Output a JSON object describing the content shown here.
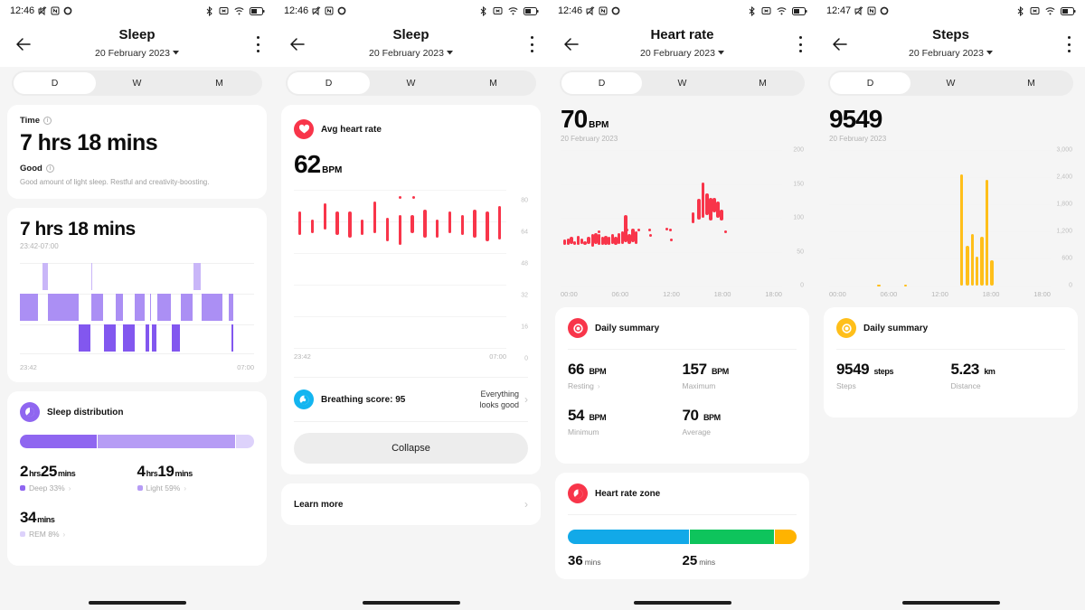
{
  "panels": [
    {
      "statusbar": {
        "time": "12:46",
        "icons": [
          "silent-icon",
          "nfc-icon",
          "record-icon",
          "bluetooth-icon",
          "alarm-icon",
          "wifi-icon",
          "battery-icon"
        ]
      },
      "appbar": {
        "title": "Sleep",
        "date": "20 February 2023",
        "back": "back-arrow-icon",
        "menu": "more-options-icon"
      },
      "tabs": [
        {
          "label": "D",
          "active": true
        },
        {
          "label": "W",
          "active": false
        },
        {
          "label": "M",
          "active": false
        }
      ],
      "time_card": {
        "label": "Time",
        "value": "7 hrs 18 mins",
        "quality": "Good",
        "description": "Good amount of light sleep. Restful and creativity-boosting."
      },
      "hypnogram_card": {
        "total": "7 hrs 18 mins",
        "range": "23:42-07:00",
        "axis_start": "23:42",
        "axis_end": "07:00"
      },
      "distribution": {
        "title": "Sleep distribution",
        "segments": [
          {
            "name": "Deep",
            "percent": 33,
            "color": "#8f66f0"
          },
          {
            "name": "Light",
            "percent": 59,
            "color": "#b69cf5"
          },
          {
            "name": "REM",
            "percent": 8,
            "color": "#ddd2fb"
          }
        ],
        "stats": [
          {
            "value": "2",
            "unit1": "hrs",
            "value2": "25",
            "unit2": "mins",
            "label": "Deep 33%",
            "color": "#8f66f0",
            "chevron": true
          },
          {
            "value": "4",
            "unit1": "hrs",
            "value2": "19",
            "unit2": "mins",
            "label": "Light 59%",
            "color": "#b69cf5",
            "chevron": true
          },
          {
            "value": "34",
            "unit1": "mins",
            "value2": "",
            "unit2": "",
            "label": "REM 8%",
            "color": "#ddd2fb",
            "chevron": true
          }
        ]
      }
    },
    {
      "statusbar": {
        "time": "12:46"
      },
      "appbar": {
        "title": "Sleep",
        "date": "20 February 2023"
      },
      "tabs": [
        {
          "label": "D",
          "active": true
        },
        {
          "label": "W",
          "active": false
        },
        {
          "label": "M",
          "active": false
        }
      ],
      "avg_hr": {
        "title": "Avg heart rate",
        "value": "62",
        "unit": "BPM",
        "axis_start": "23:42",
        "axis_end": "07:00"
      },
      "breathing": {
        "title": "Breathing score: 95",
        "status_line1": "Everything",
        "status_line2": "looks good"
      },
      "collapse_label": "Collapse",
      "learn_more_label": "Learn more"
    },
    {
      "statusbar": {
        "time": "12:46"
      },
      "appbar": {
        "title": "Heart rate",
        "date": "20 February 2023"
      },
      "tabs": [
        {
          "label": "D",
          "active": true
        },
        {
          "label": "W",
          "active": false
        },
        {
          "label": "M",
          "active": false
        }
      ],
      "hero": {
        "value": "70",
        "unit": "BPM",
        "date": "20 February 2023"
      },
      "summary": {
        "title": "Daily summary",
        "items": [
          {
            "value": "66",
            "unit": "BPM",
            "label": "Resting",
            "chevron": true
          },
          {
            "value": "157",
            "unit": "BPM",
            "label": "Maximum",
            "chevron": false
          },
          {
            "value": "54",
            "unit": "BPM",
            "label": "Minimum",
            "chevron": false
          },
          {
            "value": "70",
            "unit": "BPM",
            "label": "Average",
            "chevron": false
          }
        ]
      },
      "zone": {
        "title": "Heart rate zone",
        "segments": [
          {
            "color": "#12a9e8",
            "percent": 53
          },
          {
            "color": "#0ec45c",
            "percent": 37
          },
          {
            "color": "#ffb300",
            "percent": 10
          }
        ],
        "labels": [
          {
            "value": "36",
            "unit": "mins"
          },
          {
            "value": "25",
            "unit": "mins"
          }
        ]
      }
    },
    {
      "statusbar": {
        "time": "12:47"
      },
      "appbar": {
        "title": "Steps",
        "date": "20 February 2023"
      },
      "tabs": [
        {
          "label": "D",
          "active": true
        },
        {
          "label": "W",
          "active": false
        },
        {
          "label": "M",
          "active": false
        }
      ],
      "hero": {
        "value": "9549",
        "unit": "",
        "date": "20 February 2023"
      },
      "summary": {
        "title": "Daily summary",
        "items": [
          {
            "value": "9549",
            "unit": "steps",
            "label": "Steps",
            "chevron": false
          },
          {
            "value": "5.23",
            "unit": "km",
            "label": "Distance",
            "chevron": false
          }
        ]
      }
    }
  ],
  "colors": {
    "accent_sleep": "#8f66f0",
    "accent_hr": "#f8354a",
    "accent_breathing": "#13b5f0",
    "accent_steps": "#ffbf1a",
    "card_bg": "#ffffff",
    "page_bg": "#f5f5f5"
  },
  "chart_data": [
    {
      "id": "sleep-hypnogram",
      "type": "bar",
      "title": "7 hrs 18 mins",
      "subtitle": "23:42-07:00",
      "xlabel": "",
      "ylabel": "",
      "xticks": [
        "23:42",
        "07:00"
      ],
      "levels": [
        "REM",
        "Light",
        "Deep"
      ],
      "level_colors": {
        "REM": "#c9b6f8",
        "Light": "#ab8ff4",
        "Deep": "#8257ef"
      },
      "segments": [
        {
          "level": "Light",
          "start": 0.0,
          "width": 0.055
        },
        {
          "level": "Light",
          "start": 0.055,
          "width": 0.022
        },
        {
          "level": "REM",
          "start": 0.098,
          "width": 0.02
        },
        {
          "level": "Light",
          "start": 0.118,
          "width": 0.002
        },
        {
          "level": "Light",
          "start": 0.122,
          "width": 0.128
        },
        {
          "level": "Deep",
          "start": 0.25,
          "width": 0.052
        },
        {
          "level": "REM",
          "start": 0.305,
          "width": 0.004
        },
        {
          "level": "Light",
          "start": 0.305,
          "width": 0.05
        },
        {
          "level": "Deep",
          "start": 0.358,
          "width": 0.05
        },
        {
          "level": "Light",
          "start": 0.41,
          "width": 0.03
        },
        {
          "level": "Deep",
          "start": 0.441,
          "width": 0.048
        },
        {
          "level": "Light",
          "start": 0.492,
          "width": 0.042
        },
        {
          "level": "Deep",
          "start": 0.537,
          "width": 0.014
        },
        {
          "level": "Light",
          "start": 0.555,
          "width": 0.006
        },
        {
          "level": "Deep",
          "start": 0.562,
          "width": 0.02
        },
        {
          "level": "Light",
          "start": 0.585,
          "width": 0.06
        },
        {
          "level": "Deep",
          "start": 0.648,
          "width": 0.035
        },
        {
          "level": "Light",
          "start": 0.686,
          "width": 0.05
        },
        {
          "level": "REM",
          "start": 0.74,
          "width": 0.033
        },
        {
          "level": "Light",
          "start": 0.775,
          "width": 0.09
        },
        {
          "level": "Light",
          "start": 0.89,
          "width": 0.02
        },
        {
          "level": "Deep",
          "start": 0.905,
          "width": 0.006
        }
      ]
    },
    {
      "id": "sleep-heart-rate",
      "type": "bar",
      "title": "Avg heart rate",
      "subtitle": "62 BPM",
      "ylim": [
        0,
        80
      ],
      "yticks": [
        0,
        16,
        32,
        48,
        64,
        80
      ],
      "xticks": [
        "23:42",
        "07:00"
      ],
      "ranges": [
        {
          "low": 57,
          "high": 69
        },
        {
          "low": 58,
          "high": 65
        },
        {
          "low": 60,
          "high": 73
        },
        {
          "low": 57,
          "high": 69
        },
        {
          "low": 56,
          "high": 69
        },
        {
          "low": 57,
          "high": 65
        },
        {
          "low": 58,
          "high": 74
        },
        {
          "low": 54,
          "high": 66
        },
        {
          "low": 52,
          "high": 67
        },
        {
          "low": 58,
          "high": 67
        },
        {
          "low": 56,
          "high": 70
        },
        {
          "low": 56,
          "high": 65
        },
        {
          "low": 58,
          "high": 69
        },
        {
          "low": 57,
          "high": 67
        },
        {
          "low": 56,
          "high": 70
        },
        {
          "low": 54,
          "high": 69
        },
        {
          "low": 55,
          "high": 72
        }
      ],
      "points": [
        {
          "x": 0.5,
          "y": 77
        },
        {
          "x": 0.565,
          "y": 77
        }
      ]
    },
    {
      "id": "heart-rate-day",
      "type": "bar",
      "title": "70 BPM",
      "subtitle": "20 February 2023",
      "ylim": [
        0,
        200
      ],
      "yticks": [
        0,
        50,
        100,
        150,
        200
      ],
      "xticks": [
        "00:00",
        "06:00",
        "12:00",
        "18:00",
        "18:00"
      ],
      "ranges": [
        {
          "x": 0.02,
          "low": 60,
          "high": 68
        },
        {
          "x": 0.035,
          "low": 60,
          "high": 70
        },
        {
          "x": 0.05,
          "low": 62,
          "high": 72
        },
        {
          "x": 0.065,
          "low": 60,
          "high": 66
        },
        {
          "x": 0.082,
          "low": 60,
          "high": 74
        },
        {
          "x": 0.098,
          "low": 62,
          "high": 70
        },
        {
          "x": 0.112,
          "low": 60,
          "high": 66
        },
        {
          "x": 0.128,
          "low": 61,
          "high": 72
        },
        {
          "x": 0.145,
          "low": 58,
          "high": 76
        },
        {
          "x": 0.16,
          "low": 62,
          "high": 78
        },
        {
          "x": 0.175,
          "low": 60,
          "high": 76
        },
        {
          "x": 0.19,
          "low": 60,
          "high": 72
        },
        {
          "x": 0.205,
          "low": 60,
          "high": 74
        },
        {
          "x": 0.22,
          "low": 60,
          "high": 72
        },
        {
          "x": 0.236,
          "low": 62,
          "high": 76
        },
        {
          "x": 0.25,
          "low": 60,
          "high": 72
        },
        {
          "x": 0.265,
          "low": 62,
          "high": 78
        },
        {
          "x": 0.28,
          "low": 62,
          "high": 80
        },
        {
          "x": 0.295,
          "low": 64,
          "high": 104
        },
        {
          "x": 0.312,
          "low": 62,
          "high": 76
        },
        {
          "x": 0.328,
          "low": 64,
          "high": 84
        },
        {
          "x": 0.342,
          "low": 62,
          "high": 80
        },
        {
          "x": 0.6,
          "low": 92,
          "high": 108
        },
        {
          "x": 0.625,
          "low": 98,
          "high": 128
        },
        {
          "x": 0.645,
          "low": 100,
          "high": 152
        },
        {
          "x": 0.662,
          "low": 104,
          "high": 136
        },
        {
          "x": 0.678,
          "low": 96,
          "high": 130
        },
        {
          "x": 0.695,
          "low": 108,
          "high": 130
        },
        {
          "x": 0.712,
          "low": 100,
          "high": 124
        },
        {
          "x": 0.728,
          "low": 96,
          "high": 112
        }
      ],
      "points": [
        {
          "x": 0.175,
          "y": 82
        },
        {
          "x": 0.3,
          "y": 84
        },
        {
          "x": 0.355,
          "y": 84
        },
        {
          "x": 0.4,
          "y": 84
        },
        {
          "x": 0.405,
          "y": 76
        },
        {
          "x": 0.48,
          "y": 86
        },
        {
          "x": 0.495,
          "y": 84
        },
        {
          "x": 0.5,
          "y": 70
        },
        {
          "x": 0.745,
          "y": 82
        }
      ]
    },
    {
      "id": "steps-day",
      "type": "bar",
      "title": "9549",
      "subtitle": "20 February 2023",
      "ylim": [
        0,
        3000
      ],
      "yticks": [
        0,
        600,
        1200,
        1800,
        2400,
        3000
      ],
      "ytick_labels": [
        "0",
        "600",
        "1,200",
        "1,800",
        "2,400",
        "3,000"
      ],
      "xticks": [
        "00:00",
        "06:00",
        "12:00",
        "18:00",
        "18:00"
      ],
      "bars": [
        {
          "x": 0.225,
          "value": 30
        },
        {
          "x": 0.345,
          "value": 30
        },
        {
          "x": 0.598,
          "value": 2460
        },
        {
          "x": 0.625,
          "value": 880
        },
        {
          "x": 0.648,
          "value": 1140
        },
        {
          "x": 0.668,
          "value": 640
        },
        {
          "x": 0.69,
          "value": 1080
        },
        {
          "x": 0.712,
          "value": 2340
        },
        {
          "x": 0.735,
          "value": 560
        }
      ],
      "bar_color": "#ffbf1a"
    }
  ]
}
